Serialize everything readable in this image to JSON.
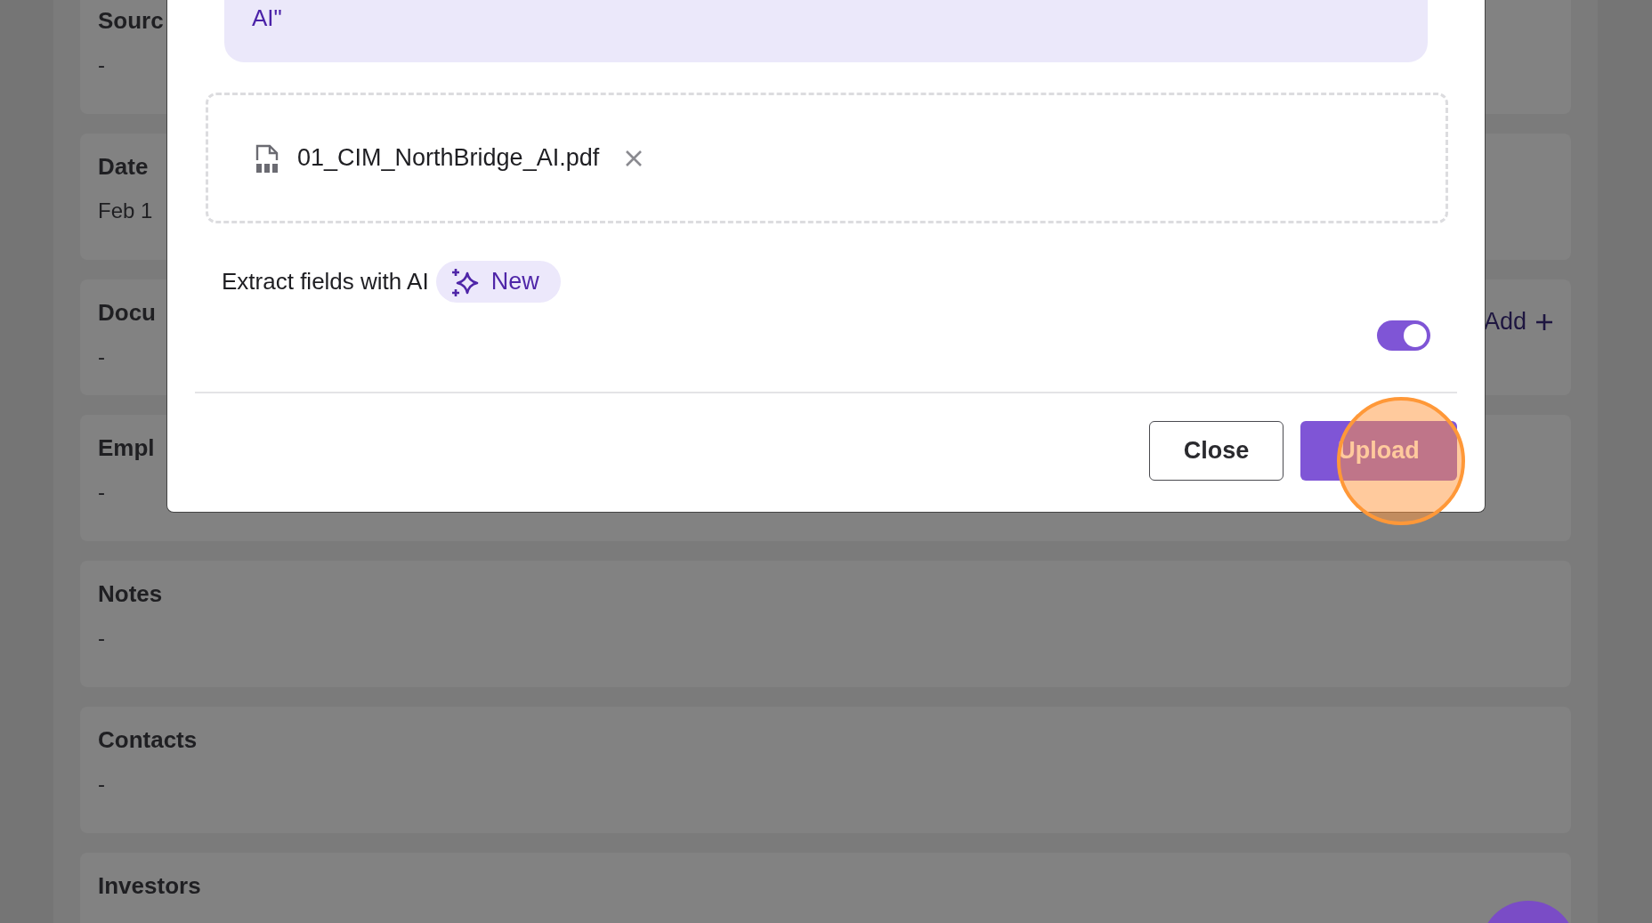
{
  "background_cards": [
    {
      "title": "Sourc",
      "value": "-"
    },
    {
      "title": "Date",
      "value": "Feb 1"
    },
    {
      "title": "Docu",
      "value": "-",
      "action": "Add"
    },
    {
      "title": "Empl",
      "value": "-"
    },
    {
      "title": "Notes",
      "value": "-"
    },
    {
      "title": "Contacts",
      "value": "-"
    },
    {
      "title": "Investors"
    }
  ],
  "modal": {
    "quote_tail": "AI\"",
    "file": {
      "name": "01_CIM_NorthBridge_AI.pdf"
    },
    "extract": {
      "label": "Extract fields with AI",
      "badge": "New",
      "on": true
    },
    "buttons": [
      {
        "label": "Close",
        "kind": "secondary"
      },
      {
        "label": "Upload",
        "kind": "primary"
      }
    ]
  }
}
